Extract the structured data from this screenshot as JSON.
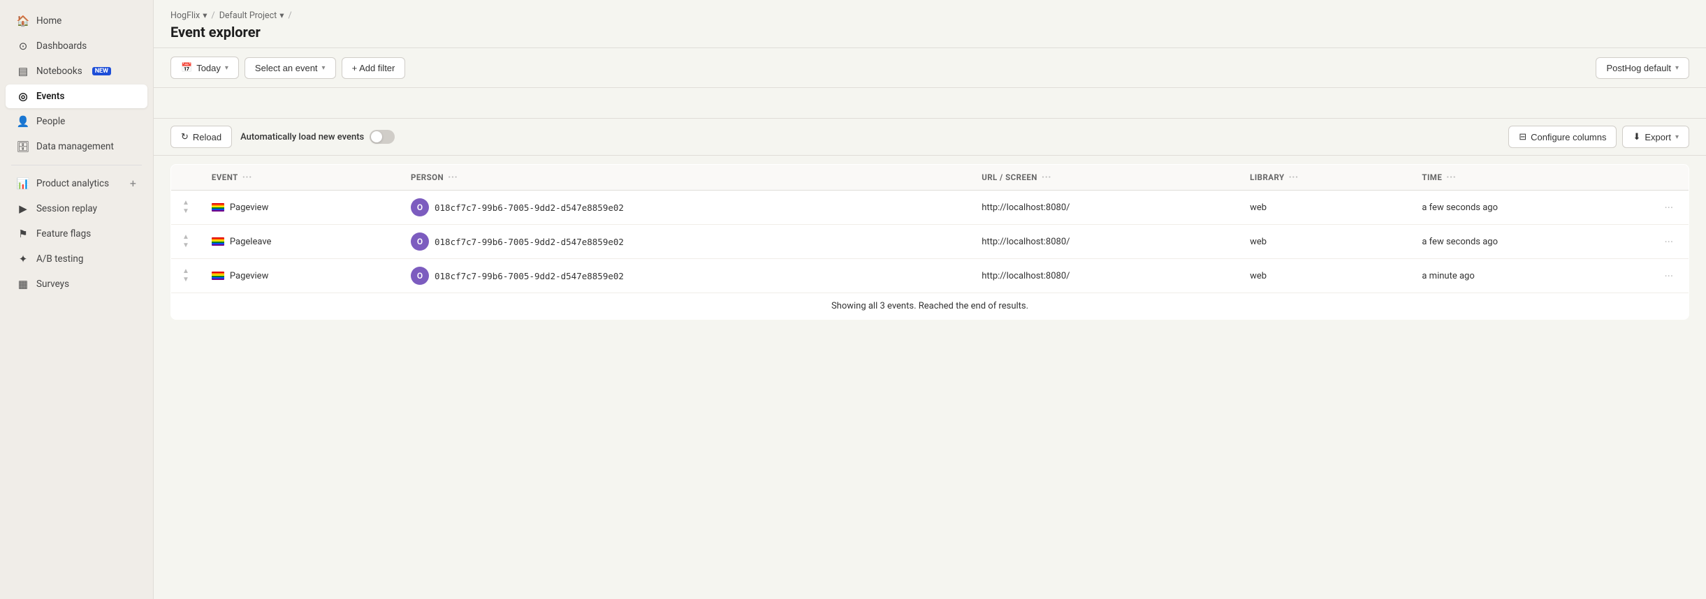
{
  "sidebar": {
    "items": [
      {
        "id": "home",
        "label": "Home",
        "icon": "🏠",
        "active": false
      },
      {
        "id": "dashboards",
        "label": "Dashboards",
        "icon": "⊙",
        "active": false
      },
      {
        "id": "notebooks",
        "label": "Notebooks",
        "icon": "▤",
        "active": false,
        "badge": "NEW"
      },
      {
        "id": "events",
        "label": "Events",
        "icon": "◎",
        "active": true
      },
      {
        "id": "people",
        "label": "People",
        "icon": "👤",
        "active": false
      },
      {
        "id": "data-management",
        "label": "Data management",
        "icon": "🗄",
        "active": false
      },
      {
        "id": "product-analytics",
        "label": "Product analytics",
        "icon": "📊",
        "active": false,
        "hasPlus": true
      },
      {
        "id": "session-replay",
        "label": "Session replay",
        "icon": "▶",
        "active": false
      },
      {
        "id": "feature-flags",
        "label": "Feature flags",
        "icon": "⚑",
        "active": false
      },
      {
        "id": "ab-testing",
        "label": "A/B testing",
        "icon": "✦",
        "active": false
      },
      {
        "id": "surveys",
        "label": "Surveys",
        "icon": "▦",
        "active": false
      }
    ]
  },
  "breadcrumb": {
    "items": [
      {
        "label": "HogFlix",
        "hasChevron": true
      },
      {
        "label": "Default Project",
        "hasChevron": true
      }
    ]
  },
  "header": {
    "title": "Event explorer"
  },
  "toolbar": {
    "date_filter_label": "Today",
    "event_filter_label": "Select an event",
    "add_filter_label": "+ Add filter",
    "data_source_label": "PostHog default"
  },
  "search": {
    "placeholder": ""
  },
  "action_bar": {
    "reload_label": "Reload",
    "auto_load_label": "Automatically load new events",
    "auto_load_enabled": false,
    "configure_columns_label": "Configure columns",
    "export_label": "Export"
  },
  "table": {
    "columns": [
      {
        "id": "expand",
        "label": ""
      },
      {
        "id": "event",
        "label": "EVENT"
      },
      {
        "id": "person",
        "label": "PERSON"
      },
      {
        "id": "url",
        "label": "URL / SCREEN"
      },
      {
        "id": "library",
        "label": "LIBRARY"
      },
      {
        "id": "time",
        "label": "TIME"
      },
      {
        "id": "actions",
        "label": ""
      }
    ],
    "rows": [
      {
        "event": "Pageview",
        "person_id": "018cf7c7-99b6-7005-9dd2-d547e8859e02",
        "url": "http://localhost:8080/",
        "library": "web",
        "time": "a few seconds ago"
      },
      {
        "event": "Pageleave",
        "person_id": "018cf7c7-99b6-7005-9dd2-d547e8859e02",
        "url": "http://localhost:8080/",
        "library": "web",
        "time": "a few seconds ago"
      },
      {
        "event": "Pageview",
        "person_id": "018cf7c7-99b6-7005-9dd2-d547e8859e02",
        "url": "http://localhost:8080/",
        "library": "web",
        "time": "a minute ago"
      }
    ],
    "footer": "Showing all 3 events. Reached the end of results."
  },
  "rainbow_colors": [
    "#e40303",
    "#ff8c00",
    "#ffed00",
    "#008026",
    "#004dff",
    "#750787"
  ]
}
